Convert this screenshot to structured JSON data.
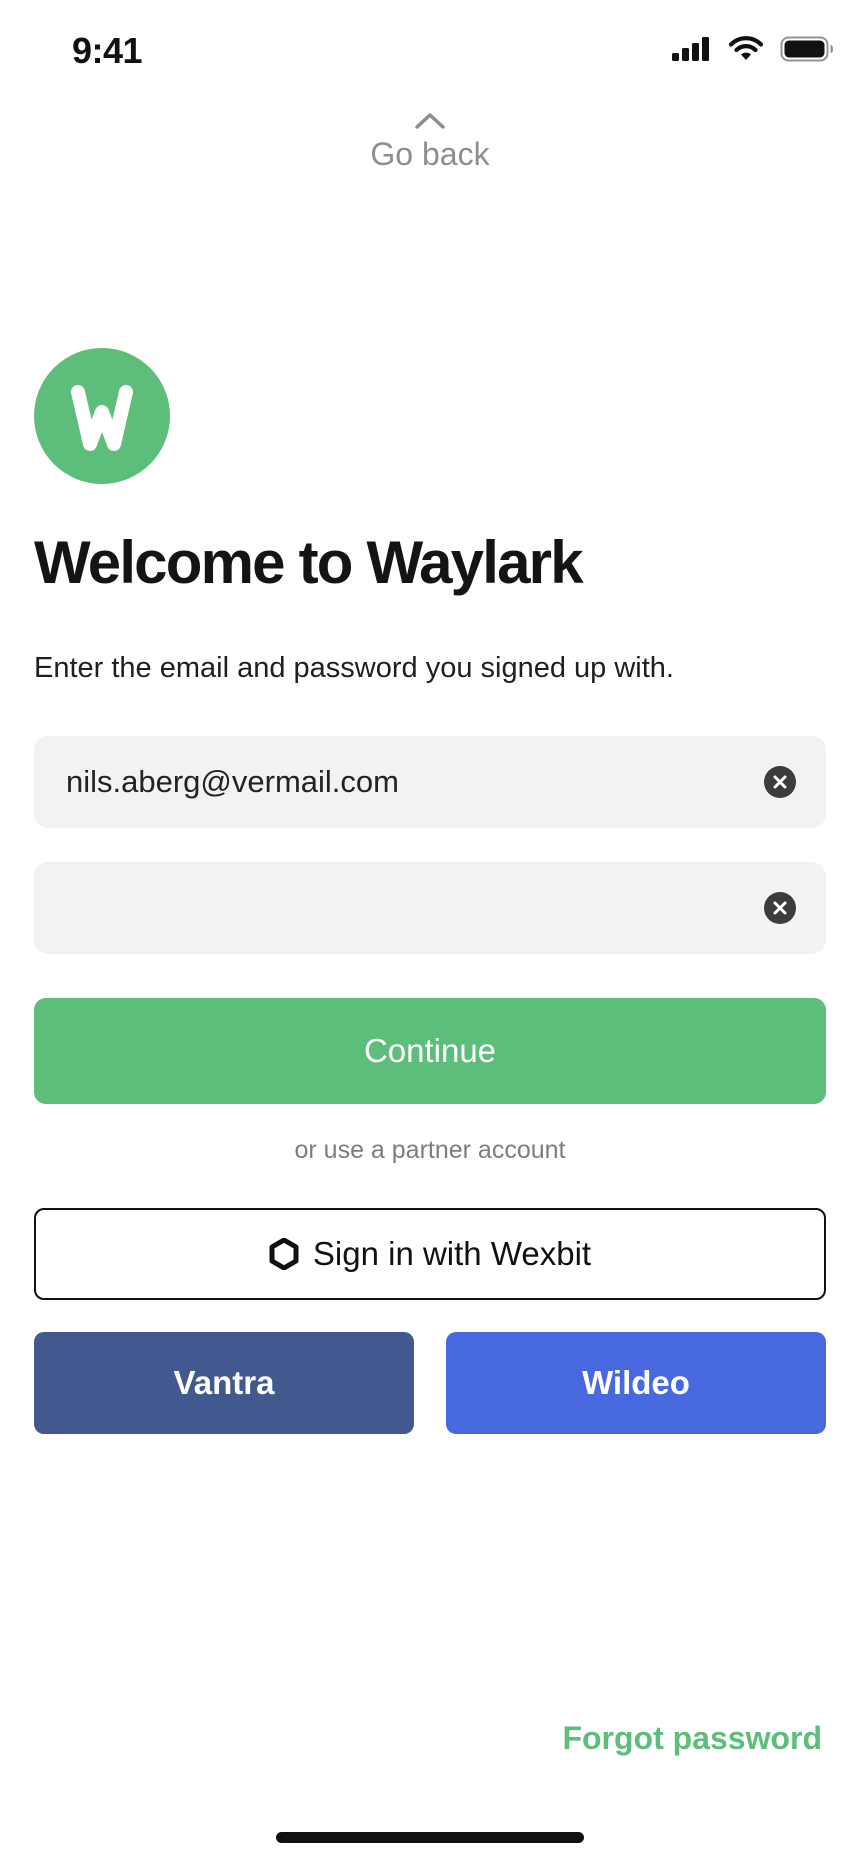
{
  "status_bar": {
    "time": "9:41",
    "icons": [
      "signal-icon",
      "wifi-icon",
      "battery-icon"
    ]
  },
  "nav": {
    "go_back_label": "Go back",
    "go_back_icon": "chevron-up-icon"
  },
  "brand": {
    "logo_letter": "W",
    "logo_color": "#5dbd7a"
  },
  "header": {
    "title": "Welcome to Waylark",
    "subtitle": "Enter the email and password you signed up with."
  },
  "form": {
    "email_value": "nils.aberg@vermail.com",
    "password_value": "",
    "clear_icon": "clear-circle-icon"
  },
  "actions": {
    "continue_label": "Continue",
    "partner_divider": "or use a partner account",
    "wexbit_label": "Sign in with Wexbit",
    "wexbit_icon": "hexagon-icon",
    "vantra_label": "Vantra",
    "wildeo_label": "Wildeo",
    "forgot_label": "Forgot password"
  },
  "colors": {
    "accent": "#5dbd7a",
    "vantra": "#42598f",
    "wildeo": "#4868e0",
    "field_bg": "#f2f2f2"
  }
}
